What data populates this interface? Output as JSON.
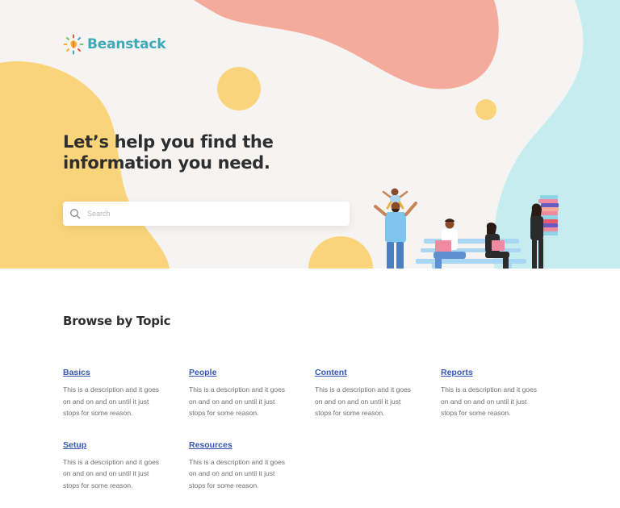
{
  "brand": {
    "name": "Beanstack"
  },
  "hero": {
    "headline": "Let’s help you find the information you need."
  },
  "search": {
    "placeholder": "Search"
  },
  "browse": {
    "title": "Browse by Topic"
  },
  "topics": [
    {
      "title": "Basics",
      "description": "This is a description and it goes on and on and on until it just stops for some reason."
    },
    {
      "title": "People",
      "description": "This is a description and it goes on and on and on until it just stops for some reason."
    },
    {
      "title": "Content",
      "description": "This is a description and it goes on and on and on until it just stops for some reason."
    },
    {
      "title": "Reports",
      "description": "This is a description and it goes on and on and on until it just stops for some reason."
    },
    {
      "title": "Setup",
      "description": "This is a description and it goes on and on and on until it just stops for some reason."
    },
    {
      "title": "Resources",
      "description": "This is a description and it goes on and on and on until it just stops for some reason."
    }
  ],
  "colors": {
    "salmon": "#f4ab9b",
    "yellow": "#f9d47a",
    "aqua": "#c5ecee",
    "hero_bg": "#f6f4f2",
    "link": "#3556b5",
    "brand": "#3fa9b8"
  }
}
